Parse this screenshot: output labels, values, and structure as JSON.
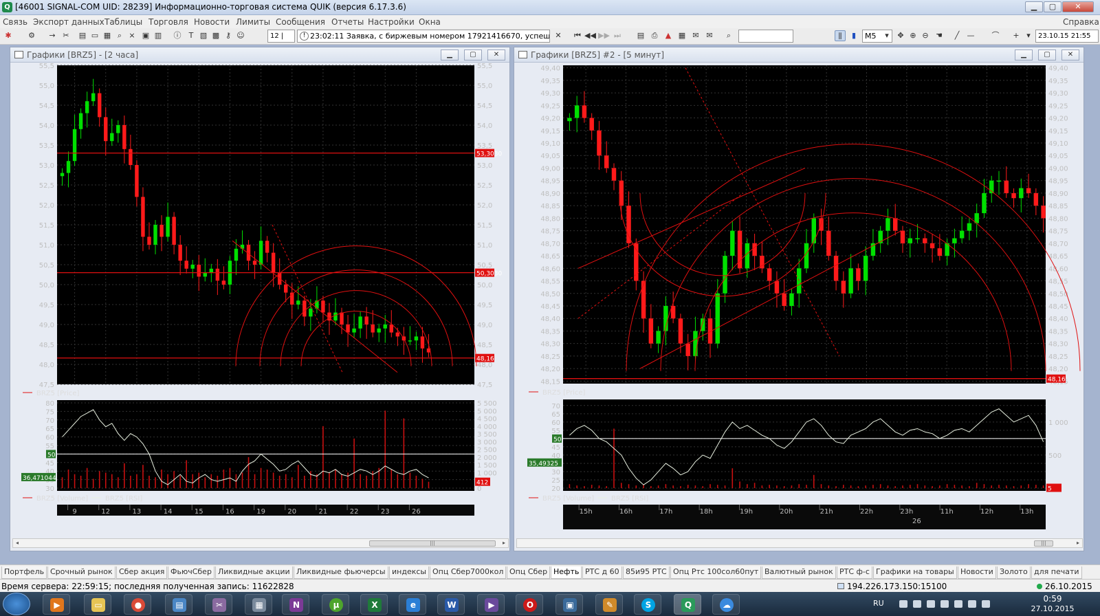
{
  "app": {
    "title": "[46001  SIGNAL-COM UID: 28239] Информационно-торговая система QUIK (версия 6.17.3.6)",
    "icon": "quik-logo-icon"
  },
  "menu": [
    "Связь",
    "Экспорт данных",
    "Таблицы",
    "Торговля",
    "Новости",
    "Лимиты",
    "Сообщения",
    "Отчеты",
    "Настройки",
    "Окна"
  ],
  "help": "Справка",
  "toolbar": {
    "counter": "12 | 12",
    "message": "23:02:11  Заявка, с биржевым номером 17921416670, успешно с",
    "interval": "M5",
    "datetime": "23.10.15 21:55"
  },
  "colors": {
    "bg": "#000000",
    "grid": "#333333",
    "bull": "#00e000",
    "bear": "#ff1a1a",
    "level": "#e01010",
    "rsi": "#e8f0e0",
    "axis": "#bfbfbf"
  },
  "windows": [
    {
      "title": "Графики [BRZ5] - [2 часа]",
      "price_legend": "BRZ5 [Price]",
      "ind_legend": [
        "BRZ5 [Volume]",
        "BRZ5 [RSI]"
      ]
    },
    {
      "title": "Графики [BRZ5] #2 - [5 минут]",
      "price_legend": "BRZ5 [Price]",
      "ind_legend": [
        "BRZ5 [Volume]",
        "BRZ5 [RSI]"
      ]
    }
  ],
  "chart_data": [
    {
      "type": "candlestick",
      "timeframe": "2 часа",
      "y_ticks": [
        "55,5",
        "55,0",
        "54,5",
        "54,0",
        "53,5",
        "53,0",
        "52,5",
        "52,0",
        "51,5",
        "51,0",
        "50,5",
        "50,0",
        "49,5",
        "49,0",
        "48,5",
        "48,0",
        "47,5"
      ],
      "ylim": [
        47.5,
        55.5
      ],
      "x_ticks": [
        "9",
        "12",
        "13",
        "14",
        "15",
        "16",
        "19",
        "20",
        "21",
        "22",
        "23",
        "26"
      ],
      "levels": [
        {
          "value": 53.3,
          "label": "53,3030"
        },
        {
          "value": 50.3,
          "label": "50,3030"
        },
        {
          "value": 48.16,
          "label": "48,16"
        }
      ],
      "closes": [
        52.8,
        53.1,
        53.9,
        54.3,
        54.6,
        54.8,
        54.2,
        53.6,
        53.8,
        54.0,
        53.4,
        53.0,
        52.2,
        51.2,
        51.0,
        51.5,
        51.2,
        51.7,
        51.0,
        50.6,
        50.4,
        50.5,
        50.2,
        50.3,
        50.4,
        50.1,
        50.0,
        50.6,
        50.9,
        51.0,
        50.6,
        50.5,
        51.1,
        50.8,
        50.3,
        50.0,
        49.8,
        49.5,
        49.6,
        49.2,
        49.4,
        49.6,
        49.3,
        49.1,
        49.3,
        49.0,
        48.8,
        48.9,
        49.2,
        49.0,
        48.8,
        48.9,
        49.0,
        48.8,
        48.7,
        48.6,
        48.6,
        48.7,
        48.4,
        48.3
      ],
      "rsi": {
        "yticks": [
          "80",
          "75",
          "70",
          "65",
          "60",
          "55",
          "50",
          "45",
          "40",
          "35",
          "30"
        ],
        "ylim": [
          30,
          80
        ],
        "level": 50,
        "current": "36,471044",
        "values": [
          60,
          64,
          68,
          72,
          74,
          76,
          70,
          66,
          68,
          62,
          58,
          62,
          60,
          56,
          50,
          40,
          34,
          32,
          35,
          38,
          34,
          33,
          36,
          38,
          35,
          34,
          35,
          36,
          34,
          40,
          44,
          46,
          50,
          47,
          44,
          40,
          41,
          44,
          46,
          42,
          38,
          37,
          40,
          39,
          41,
          38,
          37,
          39,
          41,
          40,
          38,
          40,
          43,
          41,
          39,
          38,
          40,
          41,
          38,
          36
        ]
      },
      "volume": {
        "yticks": [
          "5 500",
          "5 000",
          "4 500",
          "4 000",
          "3 500",
          "3 000",
          "2 500",
          "2 000",
          "1 500",
          "1 000",
          "500",
          "0"
        ],
        "ylim": [
          0,
          5500
        ],
        "current": "412",
        "values": [
          700,
          1200,
          900,
          800,
          1300,
          600,
          1100,
          1000,
          900,
          700,
          1600,
          800,
          900,
          1500,
          800,
          700,
          1200,
          900,
          1100,
          800,
          1800,
          900,
          1000,
          700,
          900,
          800,
          1200,
          1300,
          900,
          1000,
          2000,
          900,
          1300,
          1200,
          1000,
          800,
          900,
          700,
          1500,
          800,
          1100,
          900,
          4000,
          1000,
          1200,
          900,
          1000,
          3200,
          900,
          800,
          1100,
          1300,
          5000,
          1200,
          900,
          4500,
          1000,
          800,
          600,
          412
        ]
      }
    },
    {
      "type": "candlestick",
      "timeframe": "5 минут",
      "y_ticks": [
        "49,40",
        "49,35",
        "49,30",
        "49,25",
        "49,20",
        "49,15",
        "49,10",
        "49,05",
        "49,00",
        "48,95",
        "48,90",
        "48,85",
        "48,80",
        "48,75",
        "48,70",
        "48,65",
        "48,60",
        "48,55",
        "48,50",
        "48,45",
        "48,40",
        "48,35",
        "48,30",
        "48,25",
        "48,20",
        "48,15"
      ],
      "ylim": [
        48.14,
        49.41
      ],
      "x_ticks": [
        "15h",
        "16h",
        "17h",
        "18h",
        "19h",
        "20h",
        "21h",
        "22h",
        "23h",
        "11h",
        "12h",
        "13h"
      ],
      "x_sub": "26",
      "levels": [
        {
          "value": 48.16,
          "label": "48,16"
        }
      ],
      "closes": [
        49.2,
        49.25,
        49.2,
        49.15,
        49.05,
        49.0,
        48.95,
        48.85,
        48.7,
        48.55,
        48.4,
        48.3,
        48.35,
        48.45,
        48.4,
        48.3,
        48.25,
        48.35,
        48.4,
        48.3,
        48.5,
        48.65,
        48.75,
        48.6,
        48.7,
        48.65,
        48.6,
        48.55,
        48.5,
        48.45,
        48.5,
        48.6,
        48.7,
        48.8,
        48.75,
        48.65,
        48.55,
        48.5,
        48.6,
        48.55,
        48.65,
        48.7,
        48.75,
        48.8,
        48.75,
        48.7,
        48.72,
        48.72,
        48.7,
        48.68,
        48.65,
        48.7,
        48.72,
        48.75,
        48.78,
        48.82,
        48.9,
        48.95,
        48.95,
        48.9,
        48.88,
        48.92,
        48.9,
        48.85,
        48.8
      ],
      "rsi": {
        "yticks": [
          "70",
          "65",
          "60",
          "55",
          "50",
          "45",
          "40",
          "35",
          "30",
          "25",
          "20"
        ],
        "ylim": [
          20,
          72
        ],
        "level": 50,
        "current": "35,49325",
        "values": [
          52,
          56,
          58,
          55,
          50,
          48,
          44,
          40,
          32,
          26,
          22,
          25,
          30,
          35,
          32,
          28,
          30,
          36,
          40,
          38,
          46,
          54,
          60,
          56,
          58,
          55,
          52,
          50,
          46,
          44,
          48,
          54,
          60,
          62,
          58,
          52,
          48,
          47,
          52,
          54,
          56,
          60,
          62,
          58,
          54,
          52,
          55,
          56,
          54,
          53,
          50,
          52,
          55,
          56,
          54,
          58,
          62,
          66,
          68,
          64,
          60,
          62,
          64,
          58,
          48
        ]
      },
      "volume": {
        "yticks": [
          "1 000",
          "500"
        ],
        "ylim": [
          0,
          1300
        ],
        "current": "5",
        "values": [
          60,
          40,
          30,
          50,
          40,
          30,
          900,
          80,
          60,
          40,
          50,
          30,
          40,
          60,
          40,
          30,
          50,
          40,
          30,
          60,
          50,
          40,
          300,
          100,
          60,
          80,
          40,
          50,
          40,
          30,
          40,
          60,
          50,
          200,
          60,
          40,
          30,
          50,
          40,
          30,
          40,
          50,
          60,
          40,
          30,
          40,
          50,
          60,
          40,
          30,
          40,
          60,
          50,
          40,
          30,
          80,
          60,
          40,
          50,
          40,
          30,
          40,
          60,
          50,
          40
        ]
      }
    }
  ],
  "tabs": [
    "Портфель",
    "Срочный рынок",
    "Сбер акция",
    "ФьючСбер",
    "Ликвидные акции",
    "Ликвидные фьючерсы",
    "индексы",
    "Опц Сбер7000кол",
    "Опц Сбер",
    "Нефть",
    "РТС д 60",
    "85и95 РТС",
    "Опц Ртс 100сол60пут",
    "Валютный рынок",
    "РТС ф-с",
    "Графики на товары",
    "Новости",
    "Золото",
    "для печати"
  ],
  "active_tab": "Нефть",
  "status": {
    "left": "Время сервера: 22:59:15; последняя полученная запись: 11622828",
    "server": "194.226.173.150:15100",
    "date": "26.10.2015"
  },
  "taskbar": {
    "lang": "RU",
    "time": "0:59",
    "date": "27.10.2015"
  }
}
